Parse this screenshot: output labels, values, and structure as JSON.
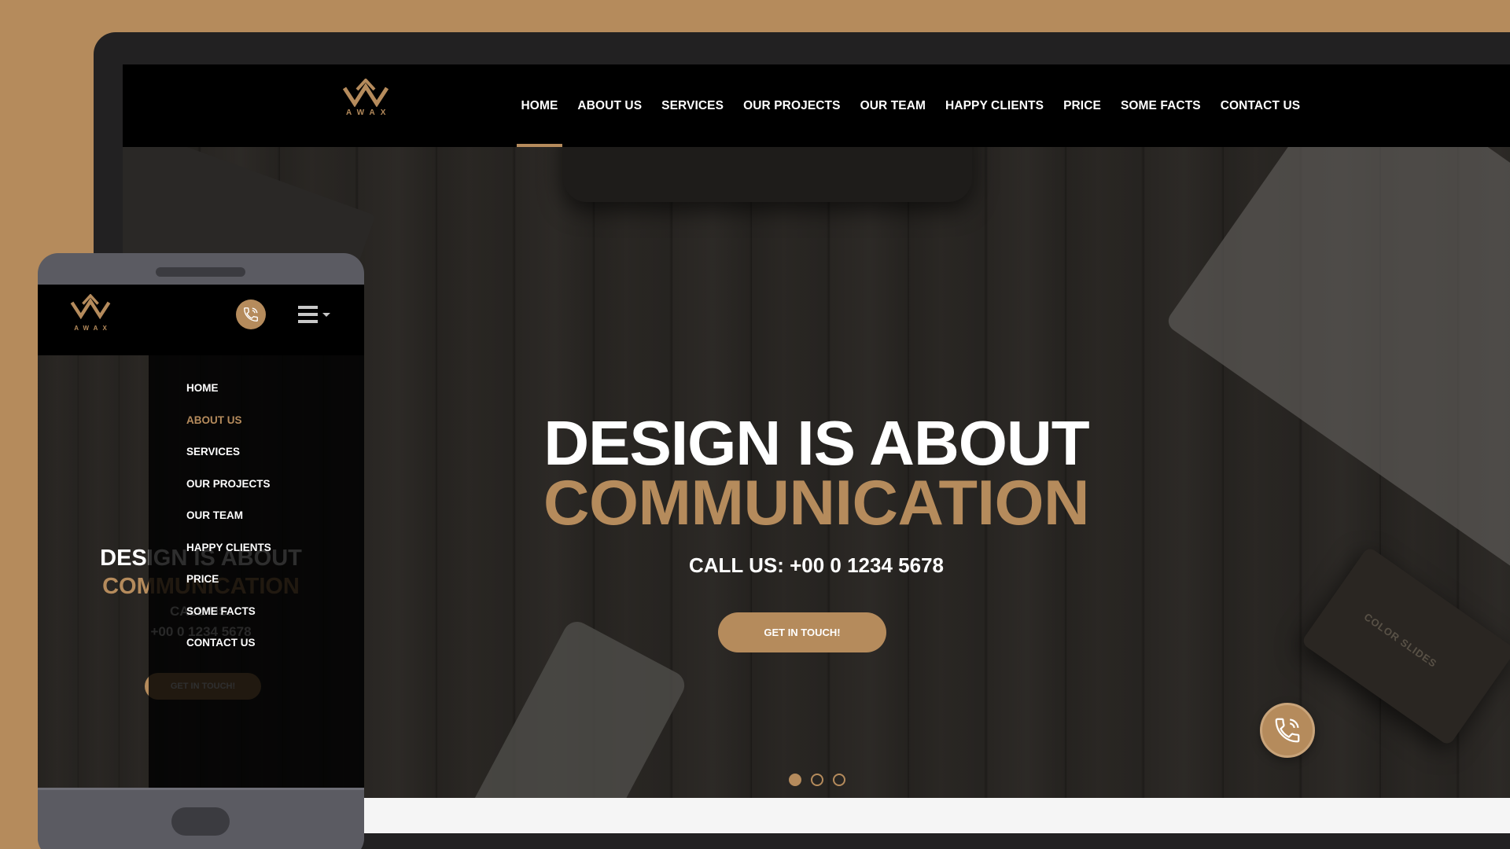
{
  "brand": {
    "logo_text": "AWAX",
    "accent_color": "#b58b5c"
  },
  "nav": {
    "items": [
      {
        "label": "HOME",
        "active": true
      },
      {
        "label": "ABOUT US"
      },
      {
        "label": "SERVICES"
      },
      {
        "label": "OUR PROJECTS"
      },
      {
        "label": "OUR TEAM"
      },
      {
        "label": "HAPPY CLIENTS"
      },
      {
        "label": "PRICE"
      },
      {
        "label": "SOME FACTS"
      },
      {
        "label": "CONTACT US"
      }
    ]
  },
  "hero": {
    "headline_1": "DESIGN IS ABOUT",
    "headline_2": "COMMUNICATION",
    "call_text": "CALL US: +00 0 1234 5678",
    "cta_label": "GET IN TOUCH!",
    "slides_total": 3,
    "slide_active": 1,
    "prop_text": "COLOR SLIDES"
  },
  "icons": {
    "float_call": "phone-icon",
    "mobile_call": "phone-icon",
    "mobile_menu": "hamburger-icon"
  },
  "mobile": {
    "call_line_1": "CALL US:",
    "call_line_2": "+00 0 1234 5678",
    "menu_items": [
      {
        "label": "HOME"
      },
      {
        "label": "ABOUT US",
        "active": true
      },
      {
        "label": "SERVICES"
      },
      {
        "label": "OUR PROJECTS"
      },
      {
        "label": "OUR TEAM"
      },
      {
        "label": "HAPPY CLIENTS"
      },
      {
        "label": "PRICE"
      },
      {
        "label": "SOME FACTS"
      },
      {
        "label": "CONTACT US"
      }
    ]
  }
}
